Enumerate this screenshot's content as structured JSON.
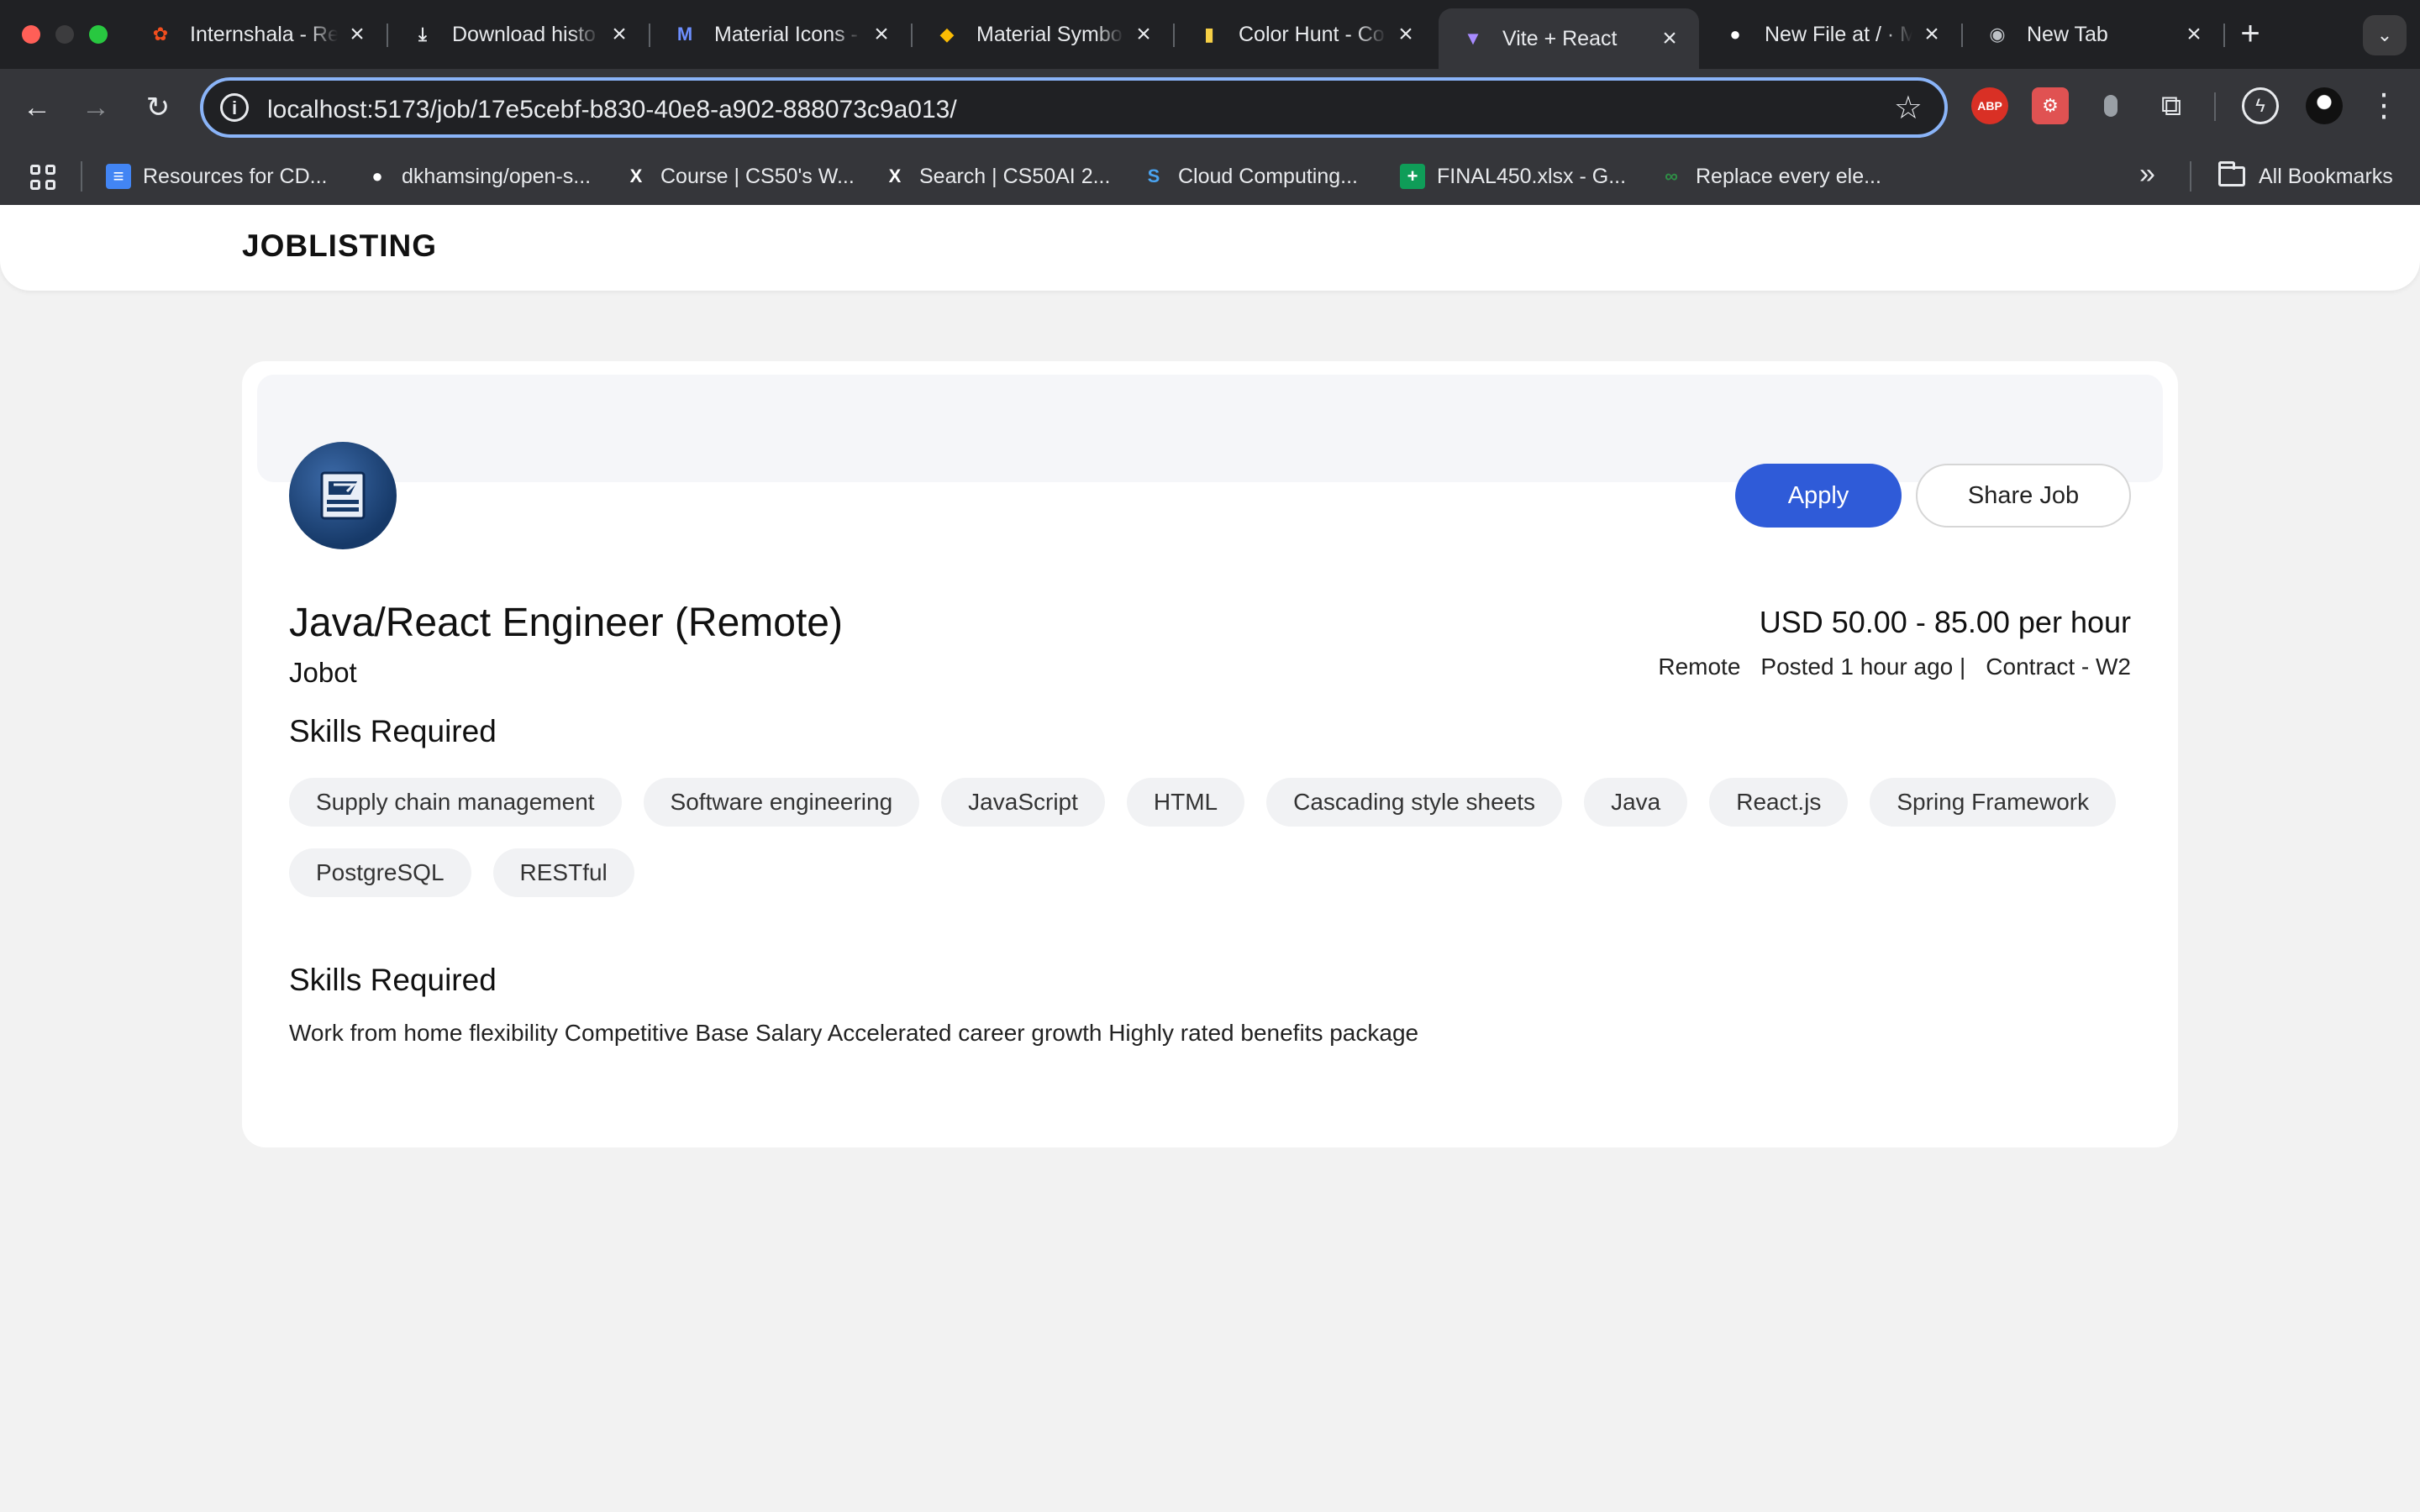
{
  "browser": {
    "tabs": [
      {
        "title": "Internshala - Re",
        "icon": "figma-icon"
      },
      {
        "title": "Download histo",
        "icon": "download-icon"
      },
      {
        "title": "Material Icons -",
        "icon": "material-icons-icon"
      },
      {
        "title": "Material Symbo",
        "icon": "material-symbols-icon"
      },
      {
        "title": "Color Hunt - Co",
        "icon": "color-hunt-icon"
      },
      {
        "title": "Vite + React",
        "icon": "vite-icon",
        "active": true
      },
      {
        "title": "New File at / · M",
        "icon": "github-icon"
      },
      {
        "title": "New Tab",
        "icon": "chrome-icon"
      }
    ],
    "url": "localhost:5173/job/17e5cebf-b830-40e8-a902-888073c9a013/",
    "bookmarks": [
      {
        "label": "Resources for CD...",
        "icon": "google-docs-icon"
      },
      {
        "label": "dkhamsing/open-s...",
        "icon": "github-icon"
      },
      {
        "label": "Course | CS50's W...",
        "icon": "edx-icon"
      },
      {
        "label": "Search | CS50AI 2...",
        "icon": "edx-icon"
      },
      {
        "label": "Cloud Computing...",
        "icon": "swayam-icon"
      },
      {
        "label": "FINAL450.xlsx - G...",
        "icon": "google-sheets-icon"
      },
      {
        "label": "Replace every ele...",
        "icon": "geeksforgeeks-icon"
      }
    ],
    "all_bookmarks_label": "All Bookmarks",
    "accent": "#8ab4f8"
  },
  "site": {
    "brand": "JOBLISTING"
  },
  "job": {
    "title": "Java/React Engineer (Remote)",
    "company": "Jobot",
    "salary": "USD 50.00 - 85.00 per hour",
    "location": "Remote",
    "posted": "Posted 1 hour ago |",
    "type": "Contract - W2",
    "logo_icon": "usps-logo-icon",
    "apply_label": "Apply",
    "share_label": "Share Job",
    "primary_color": "#2f5bd8",
    "skills_heading": "Skills Required",
    "skills": [
      "Supply chain management",
      "Software engineering",
      "JavaScript",
      "HTML",
      "Cascading style sheets",
      "Java",
      "React.js",
      "Spring Framework",
      "PostgreSQL",
      "RESTful"
    ],
    "benefits_heading": "Skills Required",
    "benefits": "Work from home flexibility Competitive Base Salary Accelerated career growth Highly rated benefits package"
  }
}
